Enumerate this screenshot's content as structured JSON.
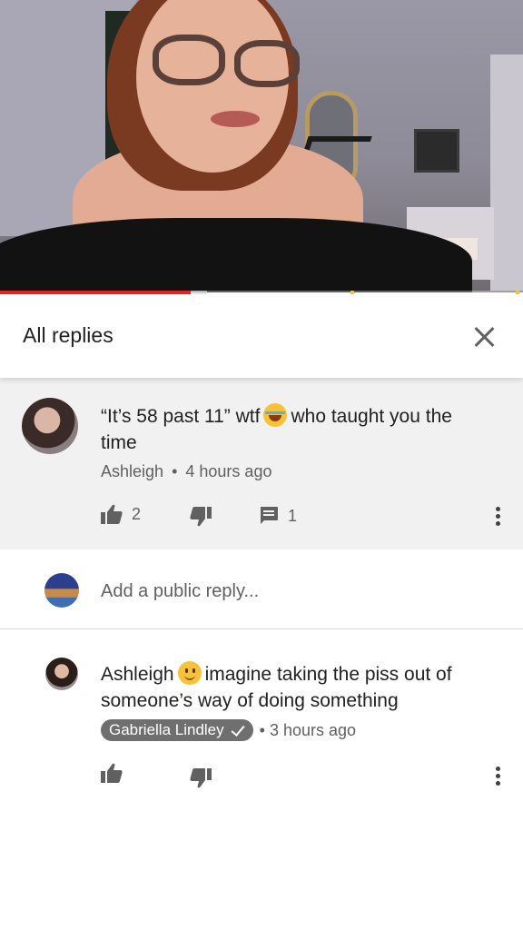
{
  "video": {
    "progress_percent": 36.5,
    "buffered_percent": 39.5,
    "colors": {
      "progress": "#e52521",
      "chapter_marker": "#f4c531"
    }
  },
  "panel": {
    "title": "All replies",
    "close_icon": "close-icon"
  },
  "parent_comment": {
    "avatar_icon": "user-avatar",
    "text_part1": "“It’s 58 past 11” wtf",
    "emoji": "face-with-tears-of-joy",
    "text_part2": "who taught you the",
    "text_part3": "time",
    "author": "Ashleigh",
    "separator": "•",
    "time": "4 hours ago",
    "like_count": "2",
    "reply_count": "1",
    "icons": [
      "thumbs-up-icon",
      "thumbs-down-icon",
      "comment-icon",
      "more-vert-icon"
    ]
  },
  "reply_input": {
    "avatar_icon": "my-avatar",
    "placeholder": "Add a public reply..."
  },
  "reply_comment": {
    "avatar_icon": "user-avatar",
    "text_part1": "Ashleigh",
    "emoji": "slightly-smiling-face",
    "text_part2": "imagine taking the piss out of",
    "text_part3": "someone’s way of doing something",
    "author": "Gabriella Lindley",
    "separator": "•",
    "time": "3 hours ago",
    "icons": [
      "thumbs-up-icon",
      "thumbs-down-icon",
      "more-vert-icon",
      "verified-check-icon"
    ]
  }
}
